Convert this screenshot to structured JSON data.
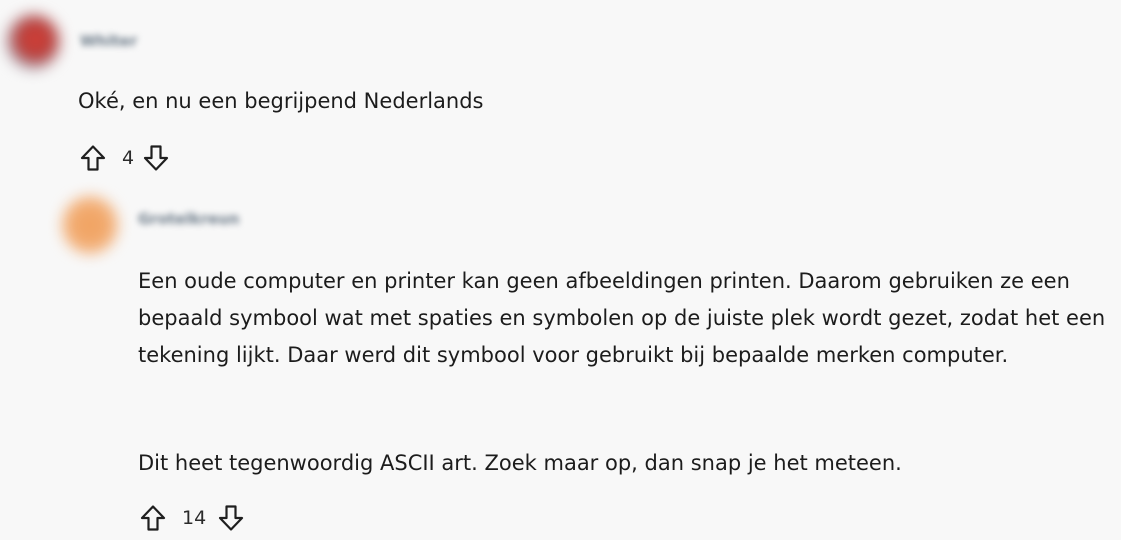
{
  "comments": [
    {
      "username": "Whiter",
      "avatar_icon": "user-avatar-red",
      "text": "Oké, en nu een begrijpend Nederlands",
      "score": "4"
    },
    {
      "username": "Grotelkreun",
      "avatar_icon": "user-avatar-orange",
      "paragraphs": [
        "Een oude computer en printer kan geen afbeeldingen printen. Daarom gebruiken ze een bepaald symbool wat met spaties en symbolen op de juiste plek wordt gezet, zodat het een tekening lijkt. Daar werd dit symbool voor gebruikt bij bepaalde merken computer.",
        "Dit heet tegenwoordig ASCII art. Zoek maar op, dan snap je het meteen."
      ],
      "score": "14"
    }
  ],
  "icons": {
    "upvote": "upvote-arrow-icon",
    "downvote": "downvote-arrow-icon"
  }
}
